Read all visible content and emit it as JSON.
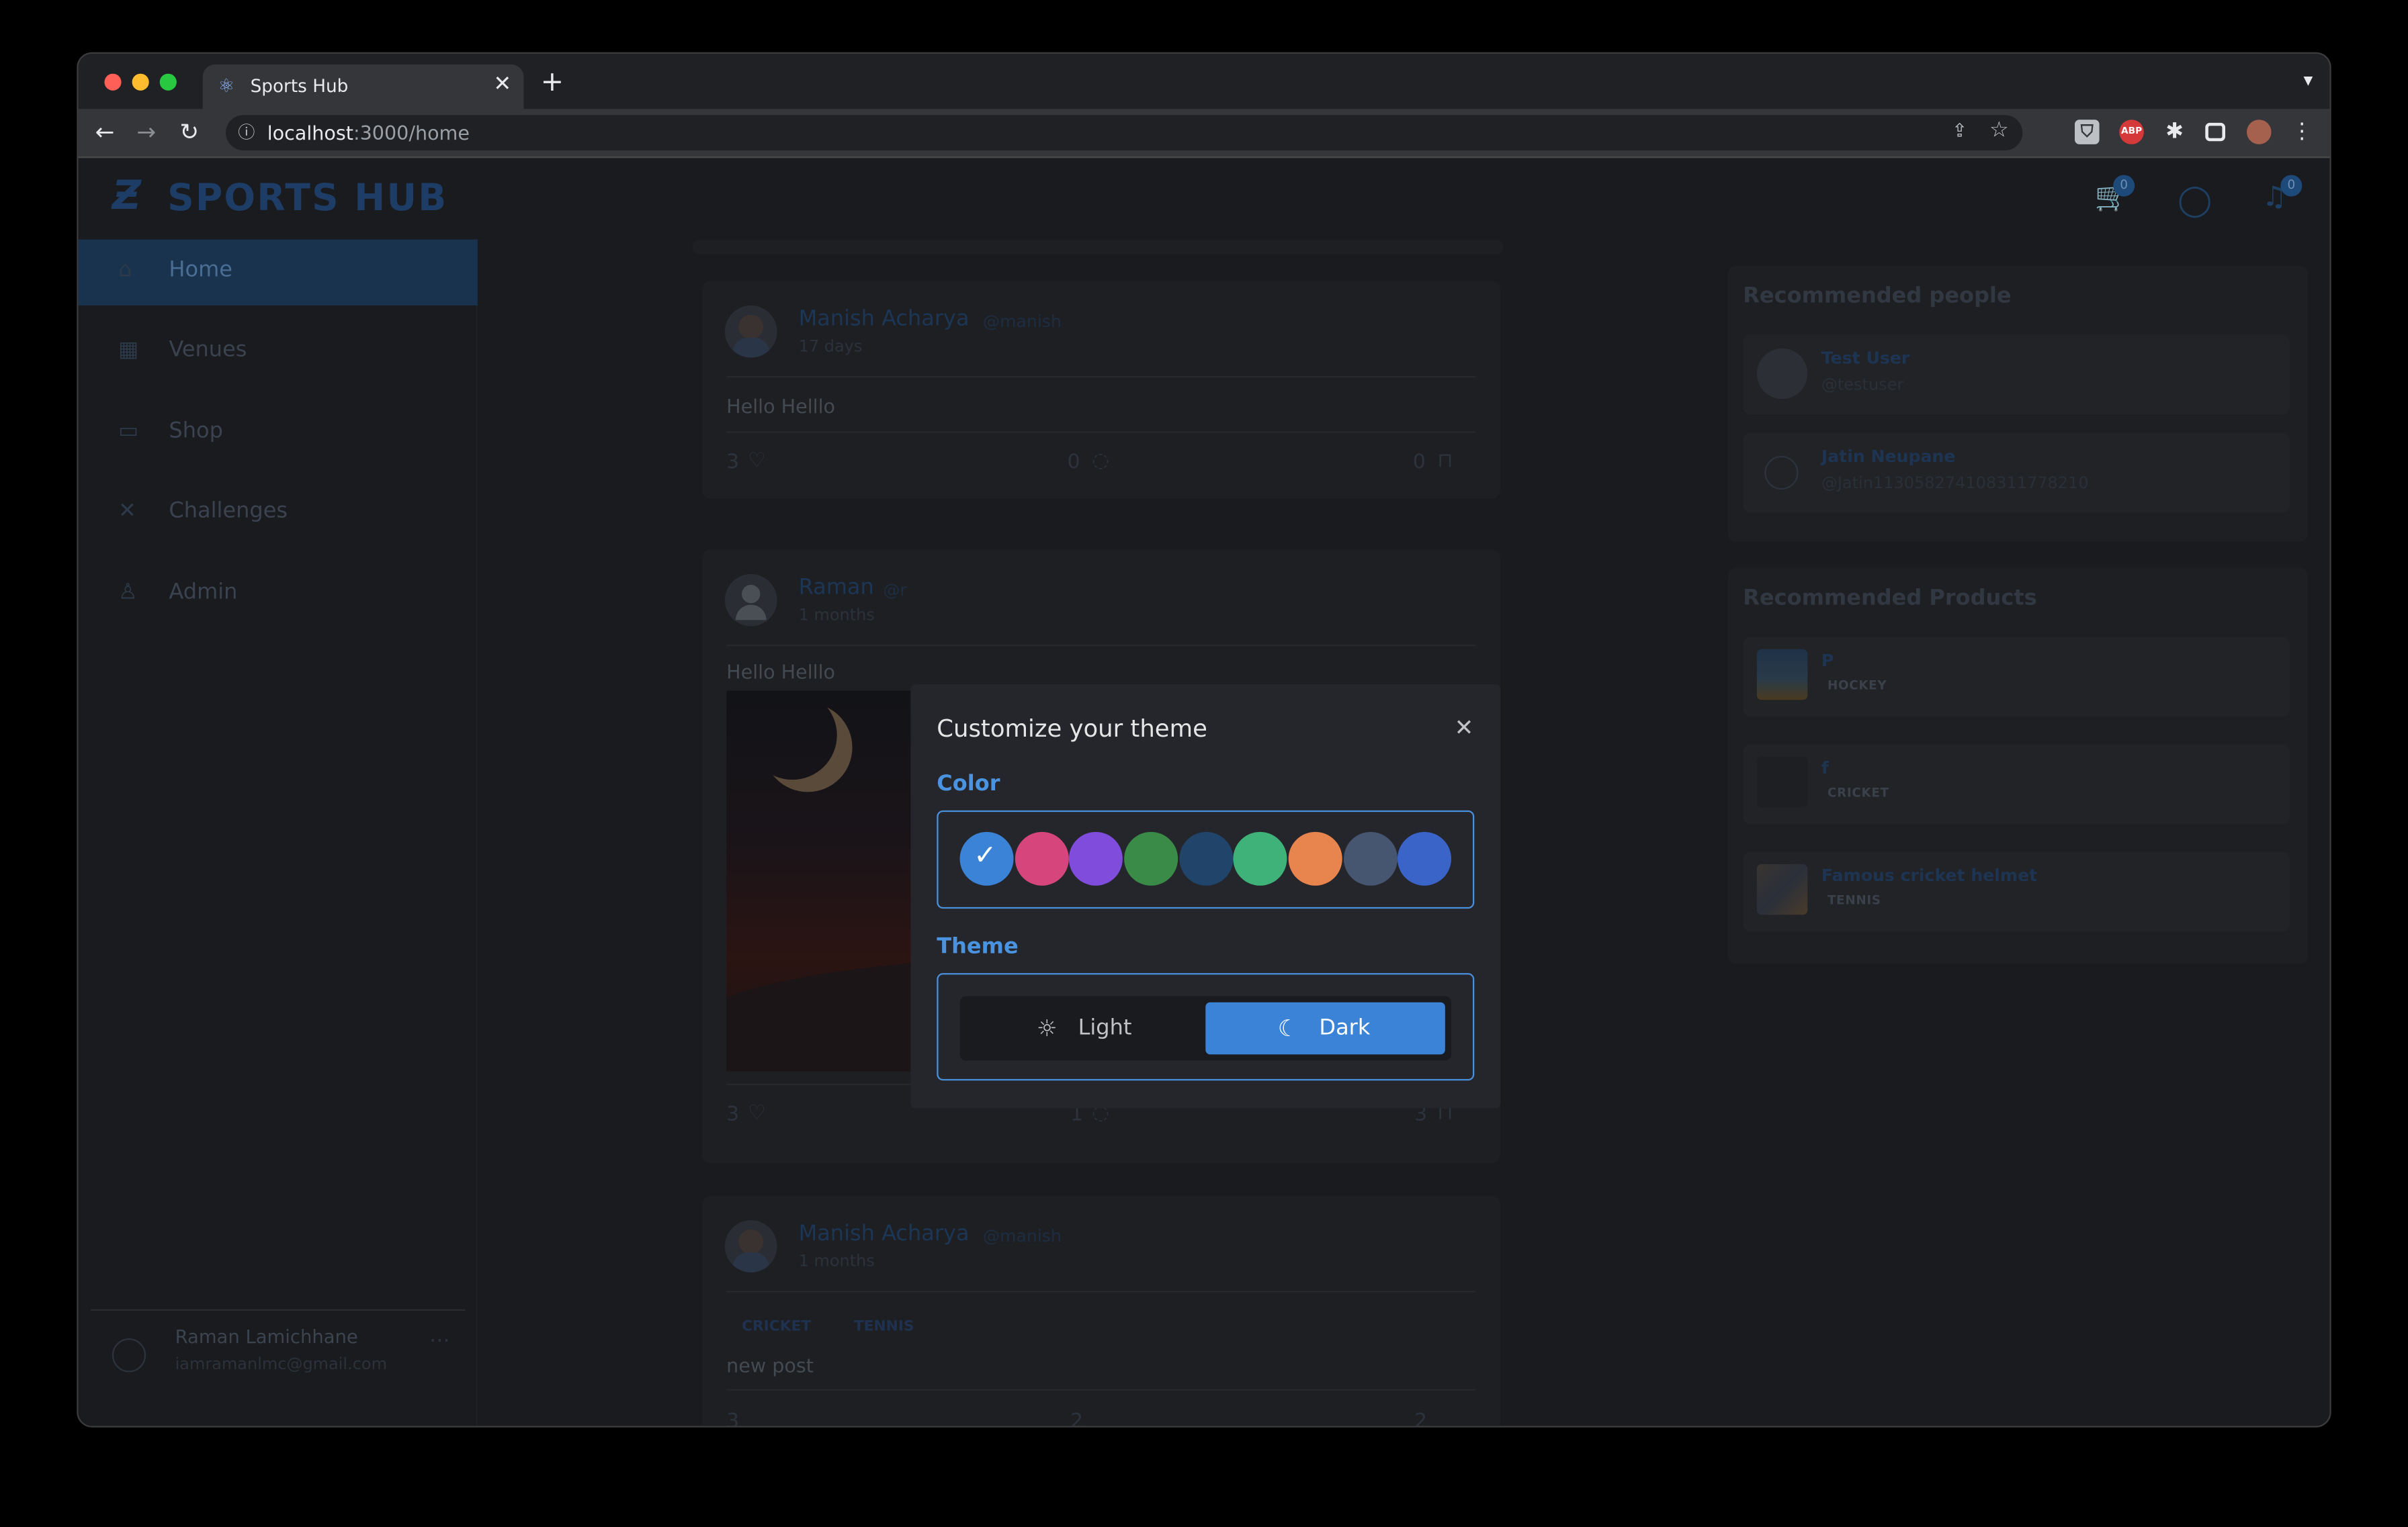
{
  "browser": {
    "tab_title": "Sports Hub",
    "url_host": "localhost",
    "url_path": ":3000/home",
    "new_tab": "+",
    "close_tab": "✕",
    "abp_label": "ABP"
  },
  "app": {
    "brand": "SPORTS HUB",
    "cart_count": "0",
    "notif_count": "0"
  },
  "sidebar": {
    "items": [
      {
        "label": "Home",
        "icon": "home-icon"
      },
      {
        "label": "Venues",
        "icon": "calendar-icon"
      },
      {
        "label": "Shop",
        "icon": "card-icon"
      },
      {
        "label": "Challenges",
        "icon": "tools-icon"
      },
      {
        "label": "Admin",
        "icon": "user-icon"
      }
    ],
    "user": {
      "name": "Raman Lamichhane",
      "email": "iamramanlmc@gmail.com",
      "more": "···"
    }
  },
  "feed": {
    "posts": [
      {
        "author": "Manish Acharya",
        "handle": "@manish",
        "time": "17 days",
        "text": "Hello Helllo",
        "likes": "3",
        "comments": "0",
        "saves": "0"
      },
      {
        "author": "Raman",
        "handle": "@r",
        "time": "1 months",
        "text": "Hello Helllo",
        "likes": "3",
        "comments": "1",
        "saves": "3"
      },
      {
        "author": "Manish Acharya",
        "handle": "@manish",
        "time": "1 months",
        "tags": [
          "CRICKET",
          "TENNIS"
        ],
        "text": "new post",
        "likes": "3",
        "comments": "2",
        "saves": "2"
      }
    ]
  },
  "recommended_people": {
    "title": "Recommended people",
    "people": [
      {
        "name": "Test User",
        "handle": "@testuser"
      },
      {
        "name": "Jatin Neupane",
        "handle": "@Jatin113058274108311778210"
      }
    ]
  },
  "recommended_products": {
    "title": "Recommended Products",
    "products": [
      {
        "name": "P",
        "tag": "HOCKEY"
      },
      {
        "name": "f",
        "tag": "CRICKET"
      },
      {
        "name": "Famous cricket helmet",
        "tag": "TENNIS"
      }
    ]
  },
  "theme_modal": {
    "title": "Customize your theme",
    "close": "✕",
    "color_label": "Color",
    "theme_label": "Theme",
    "colors": [
      "#3a83d6",
      "#d6457c",
      "#7f4cdb",
      "#3a8a48",
      "#20446a",
      "#3fb27a",
      "#e8854f",
      "#465670",
      "#3b64c8"
    ],
    "selected_color_index": 0,
    "light_label": "Light",
    "dark_label": "Dark",
    "selected_theme": "Dark"
  }
}
